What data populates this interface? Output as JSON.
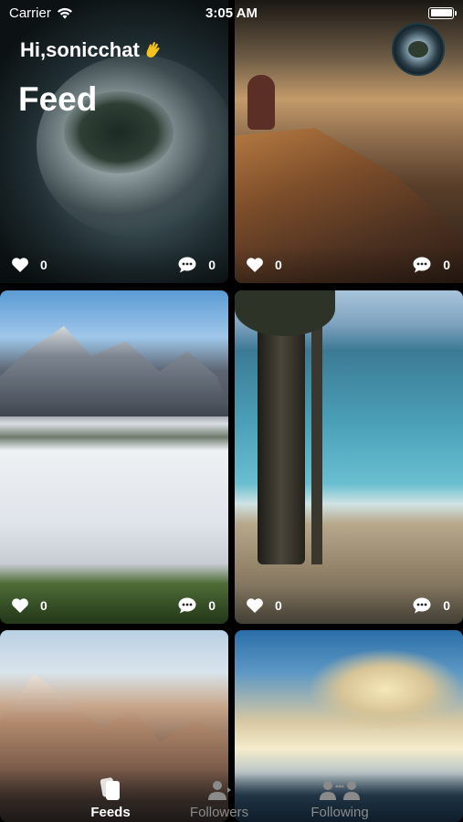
{
  "status_bar": {
    "carrier": "Carrier",
    "time": "3:05 AM"
  },
  "header": {
    "greeting": "Hi,sonicchat",
    "title": "Feed"
  },
  "cards": [
    {
      "likes": "0",
      "comments": "0"
    },
    {
      "likes": "0",
      "comments": "0"
    },
    {
      "likes": "0",
      "comments": "0"
    },
    {
      "likes": "0",
      "comments": "0"
    }
  ],
  "tabs": [
    {
      "label": "Feeds",
      "icon": "feeds-icon",
      "active": true
    },
    {
      "label": "Followers",
      "icon": "followers-icon",
      "active": false
    },
    {
      "label": "Following",
      "icon": "following-icon",
      "active": false
    }
  ],
  "colors": {
    "active_tab": "#ffffff",
    "inactive_tab": "#8a8a8a",
    "background": "#000000"
  }
}
